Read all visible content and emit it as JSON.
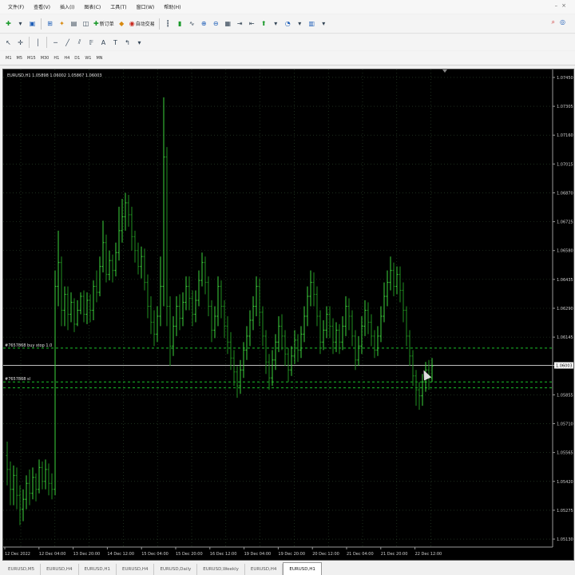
{
  "menu": [
    "文件(F)",
    "查看(V)",
    "插入(I)",
    "图表(C)",
    "工具(T)",
    "窗口(W)",
    "帮助(H)"
  ],
  "toolbar1": {
    "new_order_label": "新订单",
    "autotrade_label": "自动交易"
  },
  "timeframes": [
    "M1",
    "M5",
    "M15",
    "M30",
    "H1",
    "H4",
    "D1",
    "W1",
    "MN"
  ],
  "chart": {
    "header_text": "EURUSD,H1  1.05898 1.06002 1.05867 1.06003",
    "order_label": "#7657868 buy stop 1.0",
    "sl_label": "#7657868 sl",
    "current_price_tag": "1.06003"
  },
  "chart_data": {
    "type": "bar",
    "symbol": "EURUSD",
    "timeframe": "H1",
    "y_ticks": [
      "1.07450",
      "1.07305",
      "1.07160",
      "1.07015",
      "1.06870",
      "1.06725",
      "1.06580",
      "1.06435",
      "1.06290",
      "1.06145",
      "1.06003",
      "1.05855",
      "1.05710",
      "1.05565",
      "1.05420",
      "1.05275",
      "1.05130"
    ],
    "x_ticks": [
      "12 Dec 2022",
      "12 Dec 04:00",
      "13 Dec 20:00",
      "14 Dec 12:00",
      "15 Dec 04:00",
      "15 Dec 20:00",
      "16 Dec 12:00",
      "19 Dec 04:00",
      "19 Dec 20:00",
      "20 Dec 12:00",
      "21 Dec 04:00",
      "21 Dec 20:00",
      "22 Dec 12:00"
    ],
    "ylim": [
      1.0509,
      1.0749
    ],
    "current_price": 1.06003,
    "order_price": 1.0609,
    "sl_price": 1.0592,
    "bars": [
      [
        1.0555,
        1.0548,
        1.054,
        1.0562
      ],
      [
        1.0548,
        1.0538,
        1.053,
        1.0552
      ],
      [
        1.0538,
        1.0545,
        1.053,
        1.055
      ],
      [
        1.0545,
        1.0535,
        1.0528,
        1.0549
      ],
      [
        1.0535,
        1.0528,
        1.052,
        1.054
      ],
      [
        1.0528,
        1.0533,
        1.0522,
        1.0538
      ],
      [
        1.0533,
        1.0541,
        1.0528,
        1.0545
      ],
      [
        1.0541,
        1.0536,
        1.053,
        1.0548
      ],
      [
        1.0536,
        1.0544,
        1.0533,
        1.0549
      ],
      [
        1.0544,
        1.0538,
        1.0532,
        1.0546
      ],
      [
        1.0538,
        1.0549,
        1.0536,
        1.0553
      ],
      [
        1.0549,
        1.0542,
        1.0538,
        1.0552
      ],
      [
        1.0542,
        1.0548,
        1.0538,
        1.0553
      ],
      [
        1.0548,
        1.0541,
        1.0535,
        1.0551
      ],
      [
        1.0541,
        1.0538,
        1.0533,
        1.0546
      ],
      [
        1.0538,
        1.064,
        1.0535,
        1.0648
      ],
      [
        1.064,
        1.0652,
        1.063,
        1.0668
      ],
      [
        1.0652,
        1.0628,
        1.062,
        1.0655
      ],
      [
        1.0628,
        1.0636,
        1.062,
        1.064
      ],
      [
        1.0636,
        1.0626,
        1.0618,
        1.064
      ],
      [
        1.0626,
        1.0632,
        1.0622,
        1.0637
      ],
      [
        1.0632,
        1.0621,
        1.0617,
        1.0634
      ],
      [
        1.0621,
        1.0628,
        1.062,
        1.0633
      ],
      [
        1.0628,
        1.0635,
        1.0626,
        1.0637
      ],
      [
        1.0635,
        1.0626,
        1.0622,
        1.0638
      ],
      [
        1.0626,
        1.0633,
        1.0621,
        1.0637
      ],
      [
        1.0633,
        1.0628,
        1.0622,
        1.0636
      ],
      [
        1.0628,
        1.064,
        1.0623,
        1.0643
      ],
      [
        1.064,
        1.0637,
        1.0632,
        1.0648
      ],
      [
        1.0637,
        1.065,
        1.0635,
        1.0655
      ],
      [
        1.065,
        1.0662,
        1.0647,
        1.0673
      ],
      [
        1.0662,
        1.0646,
        1.0642,
        1.0666
      ],
      [
        1.0646,
        1.0653,
        1.0643,
        1.0658
      ],
      [
        1.0653,
        1.0648,
        1.0642,
        1.0656
      ],
      [
        1.0648,
        1.0657,
        1.0645,
        1.0662
      ],
      [
        1.0657,
        1.0668,
        1.0653,
        1.068
      ],
      [
        1.0668,
        1.0675,
        1.0662,
        1.0684
      ],
      [
        1.0675,
        1.0682,
        1.0668,
        1.0687
      ],
      [
        1.0682,
        1.0676,
        1.067,
        1.0686
      ],
      [
        1.0676,
        1.0665,
        1.0658,
        1.068
      ],
      [
        1.0665,
        1.0658,
        1.0652,
        1.0668
      ],
      [
        1.0658,
        1.065,
        1.0646,
        1.0662
      ],
      [
        1.065,
        1.0655,
        1.0644,
        1.066
      ],
      [
        1.0655,
        1.0642,
        1.0638,
        1.0659
      ],
      [
        1.0642,
        1.063,
        1.0624,
        1.0646
      ],
      [
        1.063,
        1.0622,
        1.0616,
        1.0635
      ],
      [
        1.0622,
        1.0616,
        1.061,
        1.0628
      ],
      [
        1.0616,
        1.0625,
        1.0612,
        1.063
      ],
      [
        1.0625,
        1.064,
        1.062,
        1.0655
      ],
      [
        1.064,
        1.0705,
        1.063,
        1.0735
      ],
      [
        1.0705,
        1.063,
        1.062,
        1.071
      ],
      [
        1.063,
        1.061,
        1.06,
        1.0635
      ],
      [
        1.061,
        1.062,
        1.0605,
        1.0625
      ],
      [
        1.062,
        1.063,
        1.0615,
        1.0635
      ],
      [
        1.063,
        1.0624,
        1.0618,
        1.0636
      ],
      [
        1.0624,
        1.0632,
        1.062,
        1.0637
      ],
      [
        1.0632,
        1.064,
        1.0628,
        1.0645
      ],
      [
        1.064,
        1.0634,
        1.0628,
        1.0645
      ],
      [
        1.0634,
        1.0626,
        1.062,
        1.0638
      ],
      [
        1.0626,
        1.0633,
        1.0622,
        1.0638
      ],
      [
        1.0633,
        1.0643,
        1.063,
        1.0648
      ],
      [
        1.0643,
        1.0652,
        1.064,
        1.0657
      ],
      [
        1.0652,
        1.0642,
        1.0636,
        1.0655
      ],
      [
        1.0642,
        1.063,
        1.0625,
        1.0645
      ],
      [
        1.063,
        1.0618,
        1.0612,
        1.0633
      ],
      [
        1.0618,
        1.0625,
        1.0614,
        1.063
      ],
      [
        1.0625,
        1.064,
        1.062,
        1.0645
      ],
      [
        1.064,
        1.063,
        1.0624,
        1.0643
      ],
      [
        1.063,
        1.062,
        1.0614,
        1.0633
      ],
      [
        1.062,
        1.0612,
        1.0606,
        1.0625
      ],
      [
        1.0612,
        1.0604,
        1.0598,
        1.0617
      ],
      [
        1.0604,
        1.0597,
        1.059,
        1.0608
      ],
      [
        1.0597,
        1.059,
        1.0584,
        1.06
      ],
      [
        1.059,
        1.0598,
        1.0586,
        1.0603
      ],
      [
        1.0598,
        1.0608,
        1.0594,
        1.0612
      ],
      [
        1.0608,
        1.0615,
        1.0603,
        1.062
      ],
      [
        1.0615,
        1.0623,
        1.061,
        1.0628
      ],
      [
        1.0623,
        1.063,
        1.0618,
        1.0635
      ],
      [
        1.063,
        1.064,
        1.0625,
        1.0645
      ],
      [
        1.064,
        1.0627,
        1.062,
        1.0644
      ],
      [
        1.0627,
        1.0615,
        1.061,
        1.063
      ],
      [
        1.0615,
        1.0602,
        1.0596,
        1.0618
      ],
      [
        1.0602,
        1.0594,
        1.0588,
        1.0606
      ],
      [
        1.0594,
        1.0603,
        1.059,
        1.0608
      ],
      [
        1.0603,
        1.0612,
        1.0598,
        1.0616
      ],
      [
        1.0612,
        1.062,
        1.0607,
        1.0625
      ],
      [
        1.062,
        1.0615,
        1.0608,
        1.0626
      ],
      [
        1.0615,
        1.0606,
        1.06,
        1.0618
      ],
      [
        1.0606,
        1.0598,
        1.0592,
        1.0609
      ],
      [
        1.0598,
        1.0605,
        1.0595,
        1.061
      ],
      [
        1.0605,
        1.0613,
        1.0601,
        1.0618
      ],
      [
        1.0613,
        1.0608,
        1.0602,
        1.0616
      ],
      [
        1.0608,
        1.0616,
        1.0604,
        1.062
      ],
      [
        1.0616,
        1.0625,
        1.0612,
        1.063
      ],
      [
        1.0625,
        1.0635,
        1.062,
        1.064
      ],
      [
        1.0635,
        1.0642,
        1.063,
        1.0648
      ],
      [
        1.0642,
        1.0636,
        1.063,
        1.0647
      ],
      [
        1.0636,
        1.0625,
        1.062,
        1.064
      ],
      [
        1.0625,
        1.0612,
        1.0606,
        1.0628
      ],
      [
        1.0612,
        1.0618,
        1.0608,
        1.0623
      ],
      [
        1.0618,
        1.0626,
        1.0614,
        1.063
      ],
      [
        1.0626,
        1.062,
        1.0614,
        1.063
      ],
      [
        1.062,
        1.0612,
        1.0606,
        1.0624
      ],
      [
        1.0612,
        1.0618,
        1.0607,
        1.0622
      ],
      [
        1.0618,
        1.0612,
        1.0606,
        1.0621
      ],
      [
        1.0612,
        1.062,
        1.0608,
        1.0625
      ],
      [
        1.062,
        1.063,
        1.0615,
        1.0635
      ],
      [
        1.063,
        1.0625,
        1.0618,
        1.0634
      ],
      [
        1.0625,
        1.0615,
        1.061,
        1.0628
      ],
      [
        1.0615,
        1.0603,
        1.0598,
        1.0618
      ],
      [
        1.0603,
        1.061,
        1.06,
        1.0615
      ],
      [
        1.061,
        1.062,
        1.0606,
        1.0625
      ],
      [
        1.062,
        1.0628,
        1.0615,
        1.0633
      ],
      [
        1.0628,
        1.0622,
        1.0616,
        1.0632
      ],
      [
        1.0622,
        1.0615,
        1.061,
        1.0626
      ],
      [
        1.0615,
        1.0608,
        1.0604,
        1.0618
      ],
      [
        1.0608,
        1.0615,
        1.0605,
        1.062
      ],
      [
        1.0615,
        1.0625,
        1.0612,
        1.063
      ],
      [
        1.0625,
        1.0635,
        1.0622,
        1.0642
      ],
      [
        1.0635,
        1.0642,
        1.063,
        1.0648
      ],
      [
        1.0642,
        1.0648,
        1.0638,
        1.0655
      ],
      [
        1.0648,
        1.064,
        1.0635,
        1.0652
      ],
      [
        1.064,
        1.0646,
        1.0636,
        1.065
      ],
      [
        1.0646,
        1.0638,
        1.0632,
        1.065
      ],
      [
        1.0638,
        1.0628,
        1.0622,
        1.0642
      ],
      [
        1.0628,
        1.0615,
        1.061,
        1.063
      ],
      [
        1.0615,
        1.0605,
        1.06,
        1.0618
      ],
      [
        1.0605,
        1.0595,
        1.059,
        1.0608
      ],
      [
        1.0595,
        1.0588,
        1.058,
        1.0598
      ],
      [
        1.0588,
        1.0585,
        1.0578,
        1.0592
      ],
      [
        1.0585,
        1.0592,
        1.058,
        1.0596
      ],
      [
        1.0592,
        1.0598,
        1.0587,
        1.0602
      ],
      [
        1.0598,
        1.0594,
        1.0588,
        1.0603
      ],
      [
        1.0594,
        1.06,
        1.0592,
        1.0604
      ]
    ]
  },
  "tabs": [
    "EURUSD,M5",
    "EURUSD,H4",
    "EURUSD,H1",
    "EURUSD,H4",
    "EURUSD,Daily",
    "EURUSD,Weekly",
    "EURUSD,H4",
    "EURUSD,H1"
  ]
}
